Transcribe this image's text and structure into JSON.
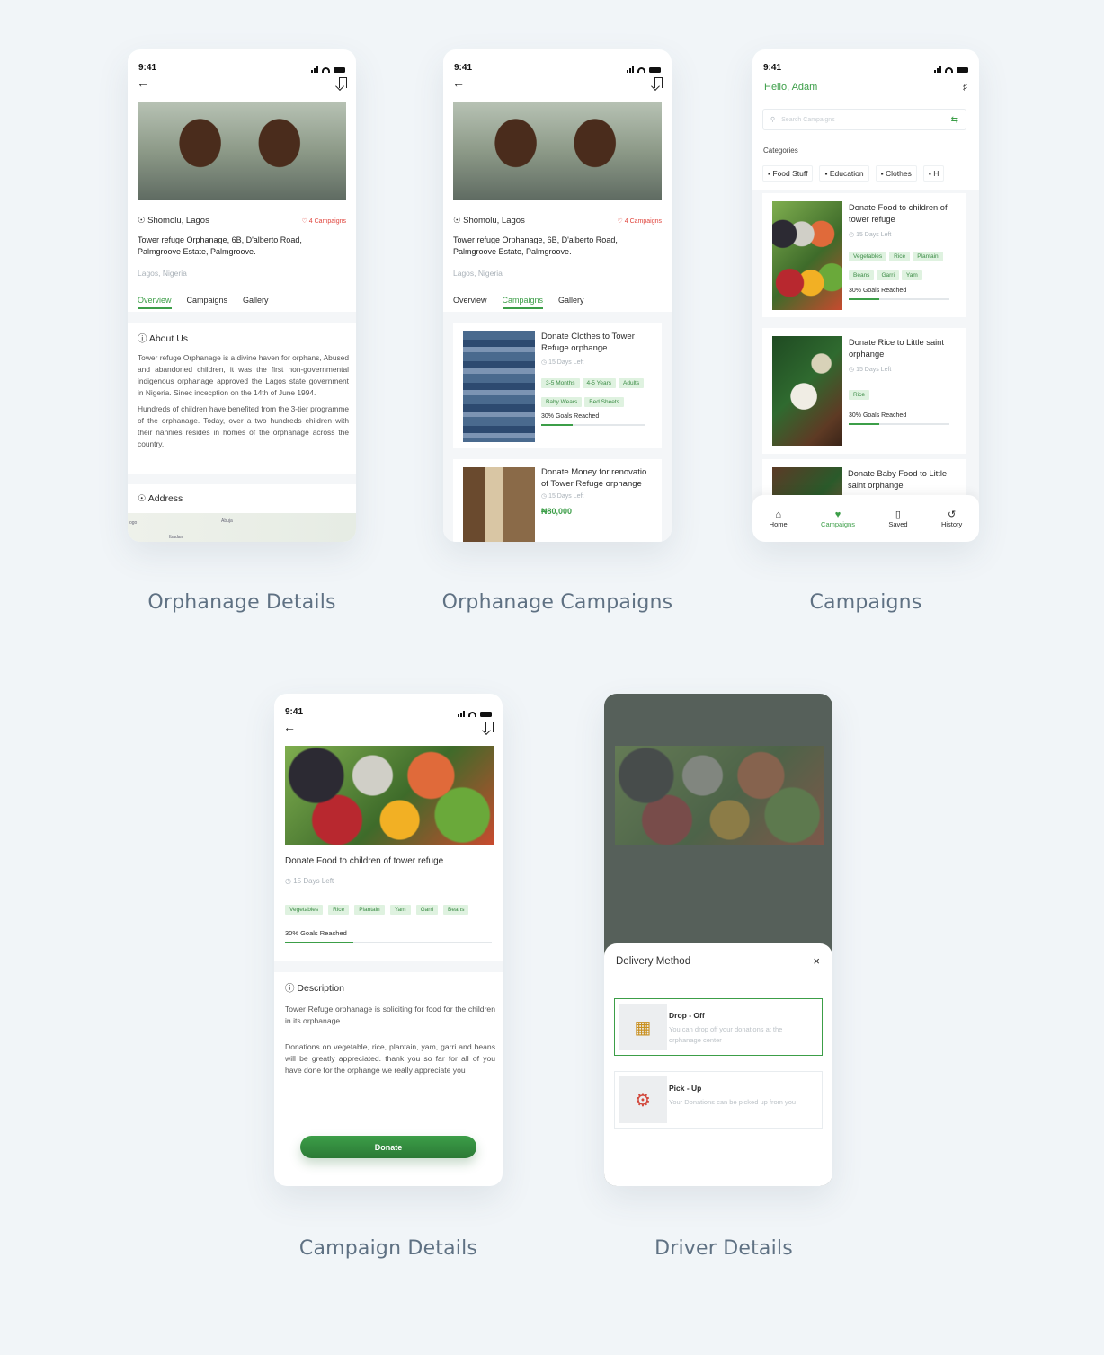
{
  "status_time": "9:41",
  "orphanage": {
    "location": "Shomolu, Lagos",
    "campaigns_badge": "4 Campaigns",
    "address": "Tower refuge Orphanage, 6B, D'alberto Road, Palmgroove Estate, Palmgroove.",
    "city": "Lagos, Nigeria",
    "tabs": [
      "Overview",
      "Campaigns",
      "Gallery"
    ],
    "about_title": "About Us",
    "about_p1": "Tower refuge Orphanage is a divine haven for orphans, Abused and abandoned children, it was the first non-governmental indigenous orphanage approved the Lagos state government in Nigeria. Sinec incecption on the 14th of June 1994.",
    "about_p2": "Hundreds of children have benefited from the 3-tier programme of the orphanage. Today, over a two hundreds children with their nannies resides in homes of the orphanage across the country.",
    "address_title": "Address",
    "map_labels": [
      "Abuja",
      "ogo",
      "Ibadan"
    ]
  },
  "orphanage_campaigns": {
    "cards": [
      {
        "title": "Donate Clothes to Tower Refuge orphange",
        "days": "15 Days Left",
        "chips": [
          "3-5 Months",
          "4-5 Years",
          "Adults",
          "Baby Wears",
          "Bed Sheets"
        ],
        "goal": "30% Goals Reached",
        "progress": 0.3
      },
      {
        "title": "Donate Money for renovatio of Tower Refuge orphange",
        "days": "15 Days Left",
        "amount": "₦80,000"
      }
    ]
  },
  "campaigns": {
    "greeting": "Hello, Adam",
    "search_placeholder": "Search Campaigns",
    "categories_label": "Categories",
    "categories": [
      "Food Stuff",
      "Education",
      "Clothes"
    ],
    "cards": [
      {
        "title": "Donate Food to children of tower refuge",
        "days": "15 Days Left",
        "chips": [
          "Vegetables",
          "Rice",
          "Plantain",
          "Beans",
          "Garri",
          "Yam"
        ],
        "goal": "30% Goals Reached",
        "progress": 0.3
      },
      {
        "title": "Donate Rice to Little saint orphange",
        "days": "15 Days Left",
        "chips": [
          "Rice"
        ],
        "goal": "30% Goals Reached",
        "progress": 0.3
      },
      {
        "title": "Donate Baby Food to Little saint orphange"
      }
    ],
    "tabbar": [
      "Home",
      "Campaigns",
      "Saved",
      "History"
    ]
  },
  "campaign_details": {
    "title": "Donate Food to children of tower refuge",
    "days": "15 Days Left",
    "chips": [
      "Vegetables",
      "Rice",
      "Plantain",
      "Yam",
      "Garri",
      "Beans"
    ],
    "goal": "30% Goals Reached",
    "progress": 0.33,
    "desc_title": "Description",
    "desc_p1": "Tower Refuge orphanage is soliciting for food for the children in its orphanage",
    "desc_p2": "Donations on vegetable, rice, plantain, yam, garri and beans will be greatly appreciated. thank you so far for all of you have done for the orphange we really appreciate you",
    "donate_label": "Donate"
  },
  "driver_details": {
    "sheet_title": "Delivery Method",
    "close": "×",
    "options": [
      {
        "title": "Drop - Off",
        "desc": "You can drop off your donations at the orphanage center"
      },
      {
        "title": "Pick - Up",
        "desc": "Your Donations can be picked up from you"
      }
    ]
  },
  "captions": [
    "Orphanage Details",
    "Orphanage Campaigns",
    "Campaigns",
    "Campaign Details",
    "Driver Details"
  ],
  "colors": {
    "accent": "#3c9e48",
    "badge_red": "#e0433b",
    "background": "#f1f5f8"
  }
}
